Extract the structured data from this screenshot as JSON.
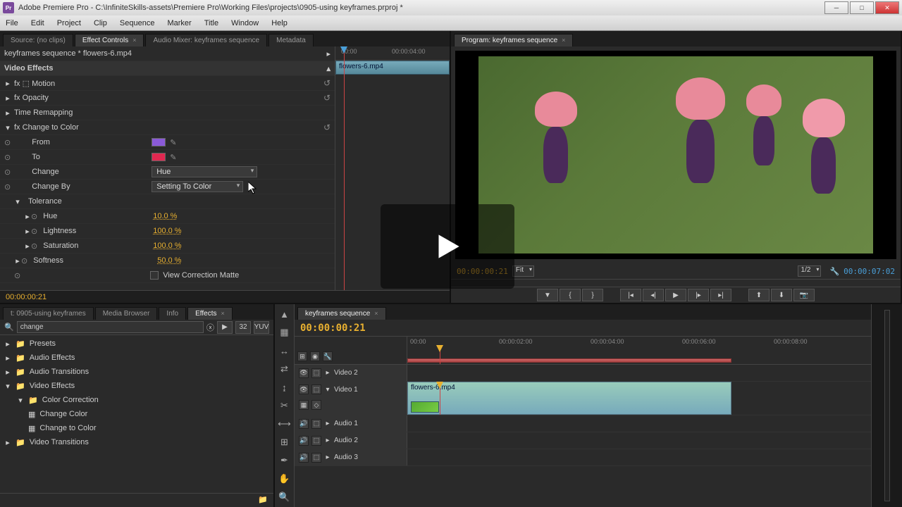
{
  "titlebar": {
    "app_prefix": "Pr",
    "title": "Adobe Premiere Pro - C:\\InfiniteSkills-assets\\Premiere Pro\\Working Files\\projects\\0905-using keyframes.prproj *"
  },
  "menu": [
    "File",
    "Edit",
    "Project",
    "Clip",
    "Sequence",
    "Marker",
    "Title",
    "Window",
    "Help"
  ],
  "source_tabs": [
    "Source: (no clips)",
    "Effect Controls",
    "Audio Mixer: keyframes sequence",
    "Metadata"
  ],
  "effect_controls": {
    "header": "keyframes sequence * flowers-6.mp4",
    "section": "Video Effects",
    "motion": "Motion",
    "opacity": "Opacity",
    "time_remap": "Time Remapping",
    "change_color": "Change to Color",
    "from": "From",
    "to": "To",
    "from_color": "#8a5ad8",
    "to_color": "#e02850",
    "change": "Change",
    "change_val": "Hue",
    "change_by": "Change By",
    "change_by_val": "Setting To Color",
    "tolerance": "Tolerance",
    "hue": "Hue",
    "hue_val": "10.0 %",
    "lightness": "Lightness",
    "lightness_val": "100.0 %",
    "saturation": "Saturation",
    "saturation_val": "100.0 %",
    "softness": "Softness",
    "softness_val": "50.0 %",
    "view_matte": "View Correction Matte",
    "tc": "00:00:00:21",
    "ruler_t0": "00:00",
    "ruler_t1": "00:00:04:00",
    "clip_label": "flowers-6.mp4"
  },
  "program": {
    "tab": "Program: keyframes sequence",
    "tc_current": "00:00:00:21",
    "fit": "Fit",
    "scale": "1/2",
    "tc_end": "00:00:07:02"
  },
  "project_tabs": [
    "t: 0905-using keyframes",
    "Media Browser",
    "Info",
    "Effects"
  ],
  "effects_browser": {
    "search": "change",
    "presets": "Presets",
    "audio_fx": "Audio Effects",
    "audio_tr": "Audio Transitions",
    "video_fx": "Video Effects",
    "color_corr": "Color Correction",
    "change_color": "Change Color",
    "change_to_color": "Change to Color",
    "video_tr": "Video Transitions"
  },
  "timeline": {
    "tab": "keyframes sequence",
    "tc": "00:00:00:21",
    "ticks": [
      "00:00",
      "00:00:02:00",
      "00:00:04:00",
      "00:00:06:00",
      "00:00:08:00"
    ],
    "video2": "Video 2",
    "video1": "Video 1",
    "audio1": "Audio 1",
    "audio2": "Audio 2",
    "audio3": "Audio 3",
    "clip": "flowers-6.mp4"
  }
}
